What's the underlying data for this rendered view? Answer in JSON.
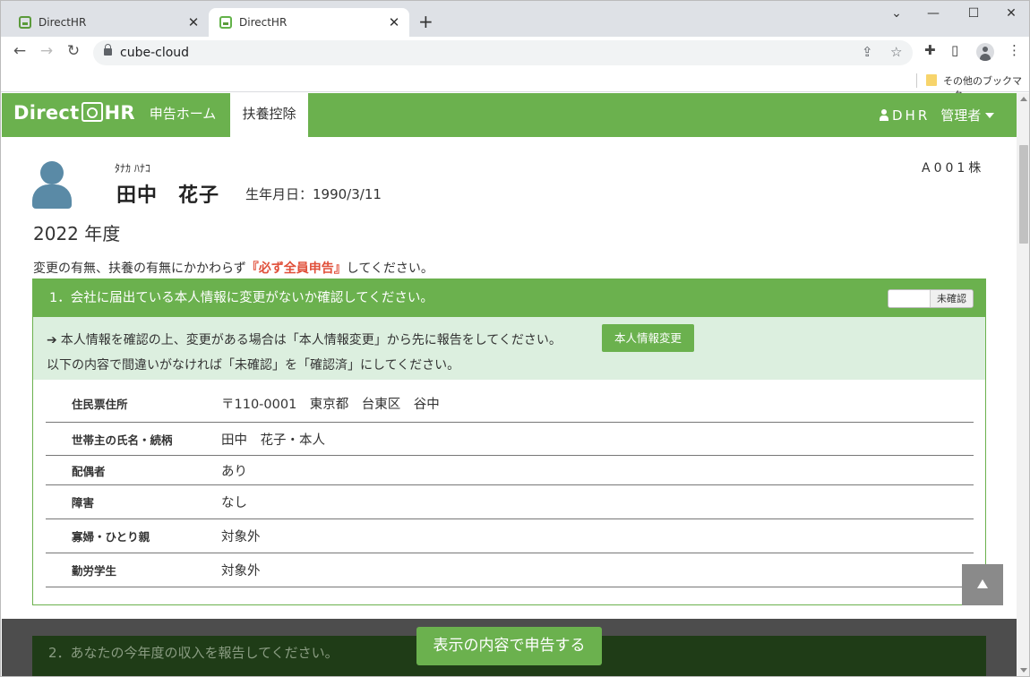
{
  "browser": {
    "tabs": [
      {
        "title": "DirectHR",
        "close": "✕"
      },
      {
        "title": "DirectHR",
        "close": "✕"
      }
    ],
    "new_tab": "+",
    "window_controls": {
      "minimize": "—",
      "maximize": "☐",
      "close": "✕",
      "tab_search": "⌄"
    },
    "url": "cube-cloud",
    "bookmarks": {
      "other": "その他のブックマーク"
    }
  },
  "nav": {
    "logo": "Direct",
    "logo_suffix": "HR",
    "links": [
      "申告ホーム",
      "扶養控除"
    ],
    "user": "DHR",
    "admin": "管理者"
  },
  "profile": {
    "furigana": "ﾀﾅｶ ﾊﾅｺ",
    "name": "田中　花子",
    "birth_label": "生年月日：1990/3/11",
    "company": "A001株"
  },
  "fiscal_year": "2022 年度",
  "notice": {
    "before": "変更の有無、扶養の有無にかかわらず",
    "emphasis": "『必ず全員申告』",
    "after": "してください。"
  },
  "section1": {
    "title": "1．会社に届出ている本人情報に変更がないか確認してください。",
    "toggle_label": "未確認",
    "info_line1": "本人情報を確認の上、変更がある場合は「本人情報変更」から先に報告をしてください。",
    "info_line2": "以下の内容で間違いがなければ「未確認」を「確認済」にしてください。",
    "change_button": "本人情報変更",
    "rows": [
      {
        "label": "住民票住所",
        "value": "〒110-0001　東京都　台東区　谷中"
      },
      {
        "label": "世帯主の氏名・続柄",
        "value": "田中　花子・本人"
      },
      {
        "label": "配偶者",
        "value": "あり"
      },
      {
        "label": "障害",
        "value": "なし"
      },
      {
        "label": "寡婦・ひとり親",
        "value": "対象外"
      },
      {
        "label": "勤労学生",
        "value": "対象外"
      }
    ]
  },
  "section2": {
    "title": "2．あなたの今年度の収入を報告してください。"
  },
  "submit_button": "表示の内容で申告する",
  "colors": {
    "brand_green": "#6bb14e",
    "emphasis_red": "#e0503a",
    "info_bg": "#dcefdf"
  }
}
